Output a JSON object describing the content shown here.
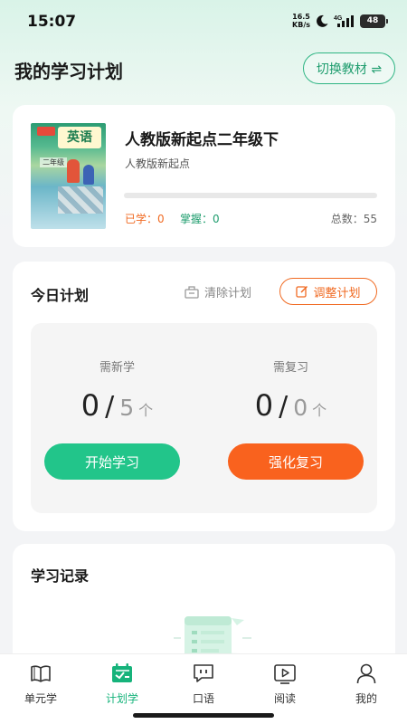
{
  "status_bar": {
    "time": "15:07",
    "net_speed_value": "16.5",
    "net_speed_unit": "KB/s",
    "network_type": "4G",
    "battery_level": "48"
  },
  "header": {
    "title": "我的学习计划",
    "switch_button_label": "切换教材 ⇌"
  },
  "book": {
    "cover_title": "英语",
    "cover_grade": "二年级",
    "name": "人教版新起点二年级下",
    "subtitle": "人教版新起点",
    "progress": 0,
    "learned_label": "已学：0",
    "mastered_label": "掌握：0",
    "total_label": "总数：55"
  },
  "today_plan": {
    "title": "今日计划",
    "clear_label": "清除计划",
    "adjust_label": "调整计划",
    "new_learn": {
      "label": "需新学",
      "done": "0",
      "slash": "/",
      "target": "5",
      "unit": "个",
      "button_label": "开始学习"
    },
    "review": {
      "label": "需复习",
      "done": "0",
      "slash": "/",
      "target": "0",
      "unit": "个",
      "button_label": "强化复习"
    }
  },
  "record": {
    "title": "学习记录"
  },
  "tabs": [
    {
      "label": "单元学",
      "icon": "book-open-icon",
      "active": false
    },
    {
      "label": "计划学",
      "icon": "calendar-check-icon",
      "active": true
    },
    {
      "label": "口语",
      "icon": "speech-bubble-icon",
      "active": false
    },
    {
      "label": "阅读",
      "icon": "video-play-icon",
      "active": false
    },
    {
      "label": "我的",
      "icon": "user-icon",
      "active": false
    }
  ],
  "colors": {
    "accent_green": "#22c58a",
    "accent_orange": "#f9621e"
  }
}
